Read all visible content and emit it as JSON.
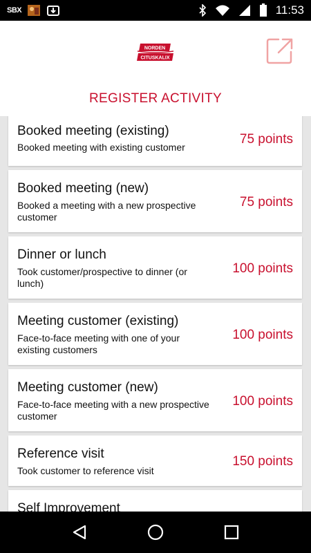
{
  "status_bar": {
    "time": "11:53",
    "icons": [
      "sbx-notification-icon",
      "photo-notification-icon",
      "download-notification-icon",
      "bluetooth-icon",
      "wifi-icon",
      "signal-icon",
      "battery-icon"
    ]
  },
  "header": {
    "logo_text_top": "NORDEN",
    "logo_text_bottom": "CITUSKALIX",
    "title": "REGISTER ACTIVITY",
    "share_icon": "external-link-icon"
  },
  "colors": {
    "accent": "#c8102e",
    "list_background": "#e6e6e6",
    "card_background": "#ffffff"
  },
  "activities": [
    {
      "title": "Booked meeting (existing)",
      "description": "Booked meeting with existing customer",
      "points": "75 points"
    },
    {
      "title": "Booked meeting (new)",
      "description": "Booked a meeting with a new prospective customer",
      "points": "75 points"
    },
    {
      "title": "Dinner or lunch",
      "description": "Took customer/prospective to dinner (or lunch)",
      "points": "100 points"
    },
    {
      "title": "Meeting customer (existing)",
      "description": "Face-to-face meeting with one of your existing customers",
      "points": "100 points"
    },
    {
      "title": "Meeting customer (new)",
      "description": "Face-to-face meeting with a new prospective customer",
      "points": "100 points"
    },
    {
      "title": "Reference visit",
      "description": "Took customer to reference visit",
      "points": "150 points"
    },
    {
      "title": "Self Improvement",
      "description": "",
      "points": ""
    }
  ],
  "nav": {
    "icons": [
      "back-icon",
      "home-icon",
      "recents-icon"
    ]
  }
}
